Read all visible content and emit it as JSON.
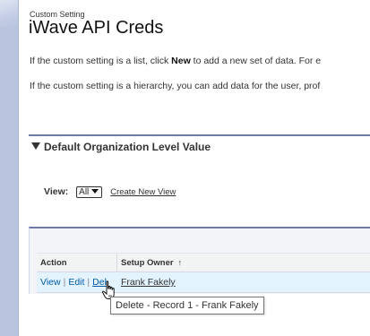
{
  "header": {
    "eyebrow": "Custom Setting",
    "title": "iWave API Creds"
  },
  "info": {
    "line1_prefix": "If the custom setting is a list, click ",
    "line1_bold": "New",
    "line1_suffix": " to add a new set of data. For e",
    "line2": "If the custom setting is a hierarchy, you can add data for the user, prof"
  },
  "section": {
    "title": "Default Organization Level Value",
    "toggle_icon": "triangle-down-icon"
  },
  "view": {
    "label": "View:",
    "selected": "All",
    "create_link": "Create New View"
  },
  "table": {
    "columns": [
      "Action",
      "Setup Owner"
    ],
    "sort_indicator": "↑",
    "rows": [
      {
        "actions": [
          "View",
          "Edit",
          "Del"
        ],
        "setup_owner": "Frank Fakely"
      }
    ]
  },
  "tooltip": {
    "text": "Delete - Record 1 - Frank Fakely"
  },
  "colors": {
    "link": "#015ba7",
    "section_border": "#6d7ba5",
    "row_highlight": "#e3f3ff",
    "sidebar": "#b9c4de"
  }
}
